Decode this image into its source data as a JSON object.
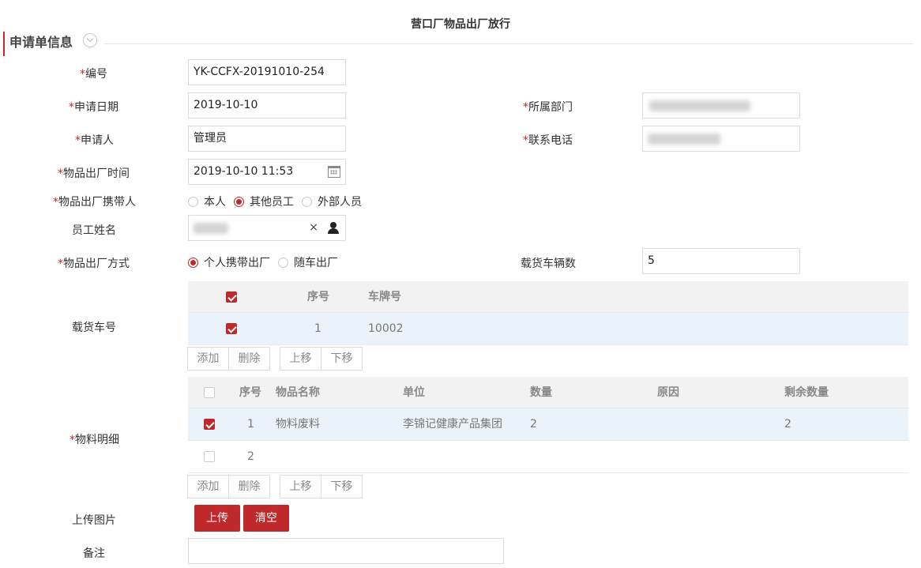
{
  "page": {
    "title": "营口厂物品出厂放行"
  },
  "section": {
    "title": "申请单信息"
  },
  "required_mark": "*",
  "fields": {
    "number": {
      "label": "编号",
      "value": "YK-CCFX-20191010-254"
    },
    "apply_date": {
      "label": "申请日期",
      "value": "2019-10-10"
    },
    "department": {
      "label": "所属部门"
    },
    "applicant": {
      "label": "申请人",
      "value": "管理员"
    },
    "phone": {
      "label": "联系电话"
    },
    "exit_time": {
      "label": "物品出厂时间",
      "value": "2019-10-10 11:53"
    },
    "carrier": {
      "label": "物品出厂携带人",
      "options": [
        "本人",
        "其他员工",
        "外部人员"
      ],
      "selected": "其他员工"
    },
    "employee_name": {
      "label": "员工姓名",
      "clear": "×"
    },
    "exit_method": {
      "label": "物品出厂方式",
      "options": [
        "个人携带出厂",
        "随车出厂"
      ],
      "selected": "个人携带出厂"
    },
    "vehicle_count": {
      "label": "载货车辆数",
      "value": "5"
    },
    "vehicle_no": {
      "label": "载货车号"
    },
    "materials": {
      "label": "物料明细"
    },
    "upload": {
      "label": "上传图片"
    },
    "remark": {
      "label": "备注",
      "value": ""
    }
  },
  "vehicle_grid": {
    "columns": [
      "序号",
      "车牌号"
    ],
    "rows": [
      {
        "seq": "1",
        "plate": "10002",
        "checked": true
      }
    ],
    "header_checked": true
  },
  "material_grid": {
    "columns": [
      "序号",
      "物品名称",
      "单位",
      "数量",
      "原因",
      "剩余数量"
    ],
    "rows": [
      {
        "seq": "1",
        "name": "物料废料",
        "unit": "李锦记健康产品集团",
        "qty": "2",
        "reason": "",
        "remaining": "2",
        "checked": true
      },
      {
        "seq": "2",
        "name": "",
        "unit": "",
        "qty": "",
        "reason": "",
        "remaining": "",
        "checked": false
      }
    ],
    "header_checked": false
  },
  "grid_buttons": {
    "add": "添加",
    "delete": "删除",
    "up": "上移",
    "down": "下移"
  },
  "upload_buttons": {
    "upload": "上传",
    "clear": "清空"
  },
  "colors": {
    "accent": "#c0292b",
    "selected_row": "#ebf3fa",
    "header_bg": "#f2f2f2"
  },
  "icons": {
    "section_toggle": "chevron-down-icon",
    "calendar": "calendar-icon",
    "clear": "close-icon",
    "user_picker": "user-icon"
  }
}
